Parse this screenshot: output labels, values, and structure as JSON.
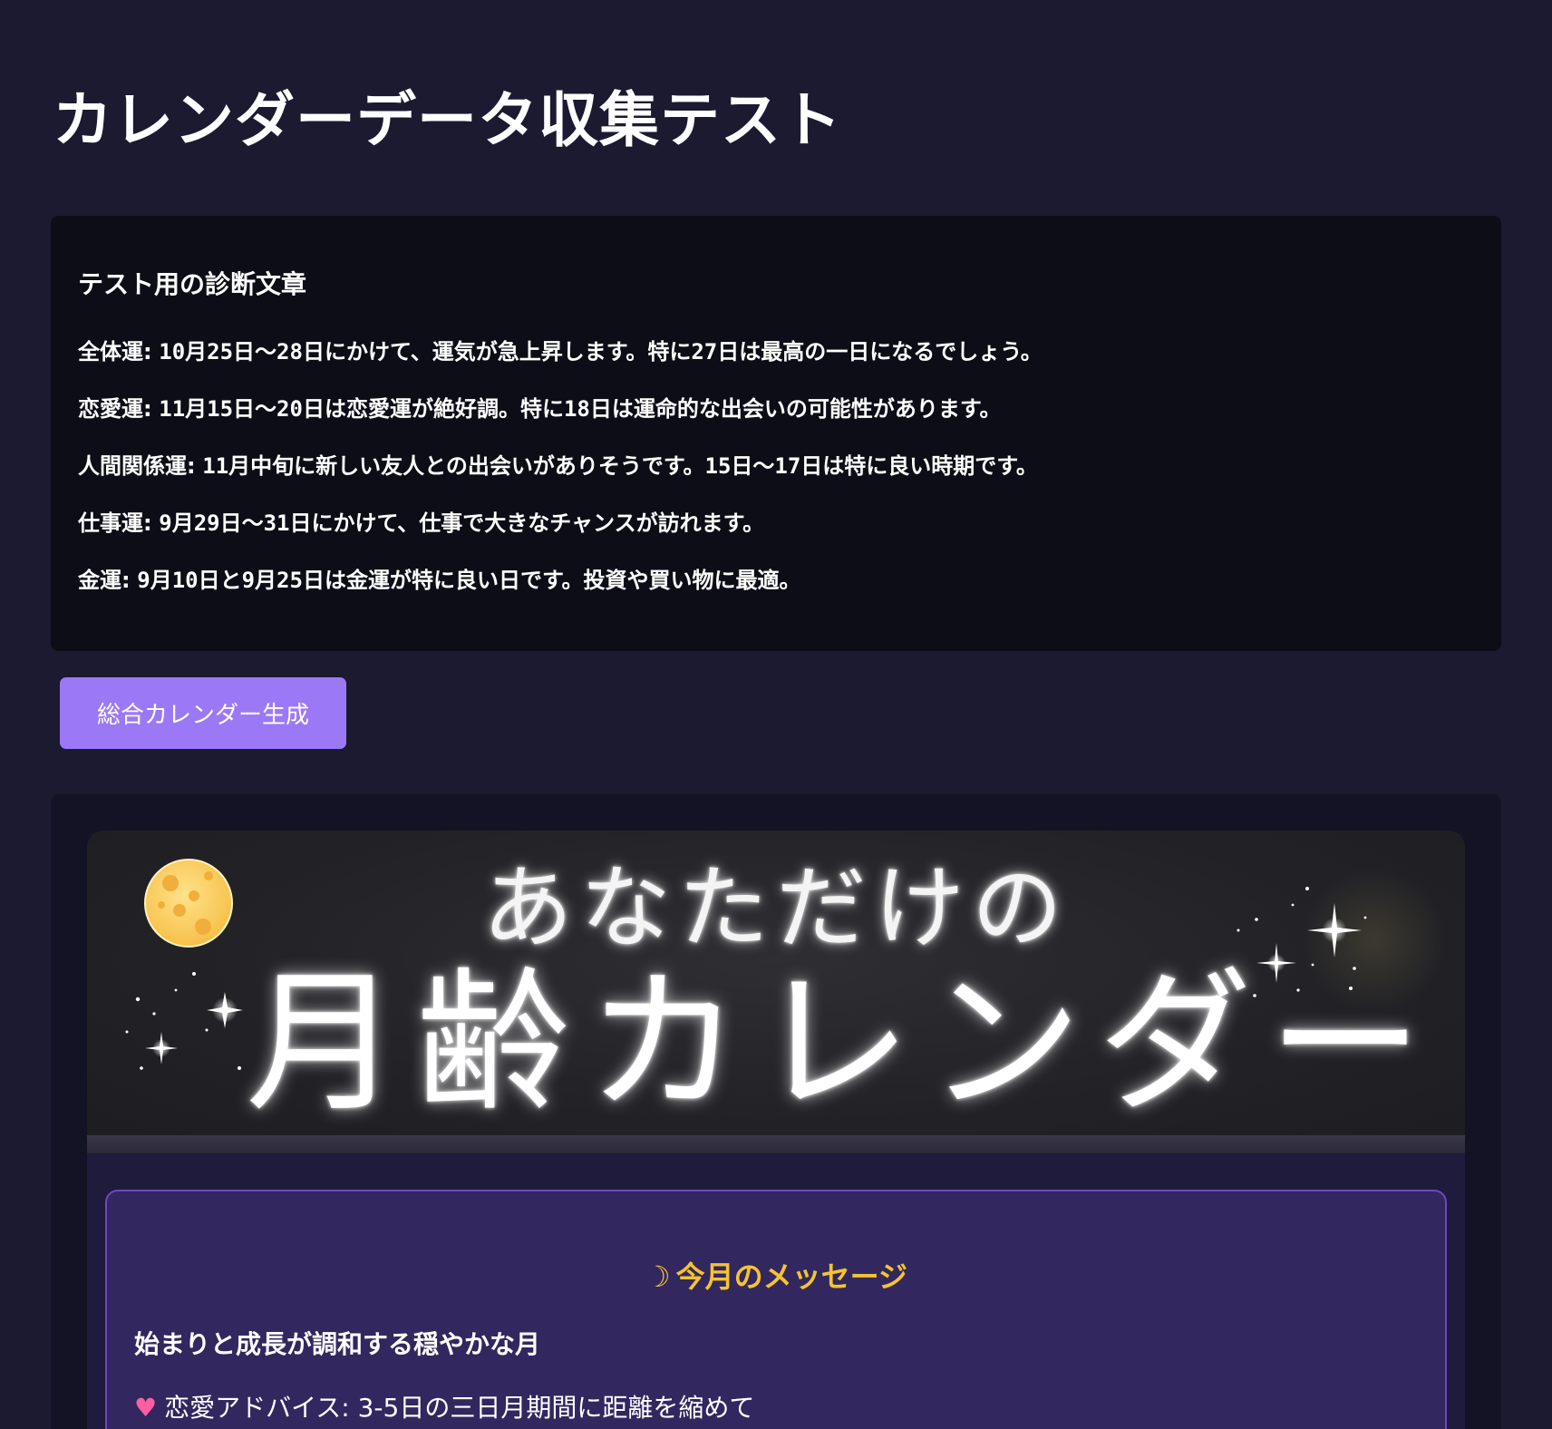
{
  "page": {
    "title": "カレンダーデータ収集テスト"
  },
  "diagnosis": {
    "heading": "テスト用の診断文章",
    "items": [
      {
        "label": "全体運:",
        "text": "10月25日〜28日にかけて、運気が急上昇します。特に27日は最高の一日になるでしょう。"
      },
      {
        "label": "恋愛運:",
        "text": "11月15日〜20日は恋愛運が絶好調。特に18日は運命的な出会いの可能性があります。"
      },
      {
        "label": "人間関係運:",
        "text": "11月中旬に新しい友人との出会いがありそうです。15日〜17日は特に良い時期です。"
      },
      {
        "label": "仕事運:",
        "text": "9月29日〜31日にかけて、仕事で大きなチャンスが訪れます。"
      },
      {
        "label": "金運:",
        "text": "9月10日と9月25日は金運が特に良い日です。投資や買い物に最適。"
      }
    ]
  },
  "actions": {
    "generate_label": "総合カレンダー生成"
  },
  "calendar": {
    "banner_subtitle": "あなただけの",
    "banner_title": "月齢カレンダー",
    "message": {
      "icon": "crescent-moon-icon",
      "heading": "今月のメッセージ",
      "theme": "始まりと成長が調和する穏やかな月",
      "love_icon": "two-hearts-icon",
      "love_advice": "恋愛アドバイス: 3-5日の三日月期間に距離を縮めて"
    }
  },
  "colors": {
    "background": "#1b1a30",
    "panel": "#0d0d17",
    "button": "#9b79f6",
    "message_card": "#33275f",
    "message_heading": "#f4c430"
  }
}
